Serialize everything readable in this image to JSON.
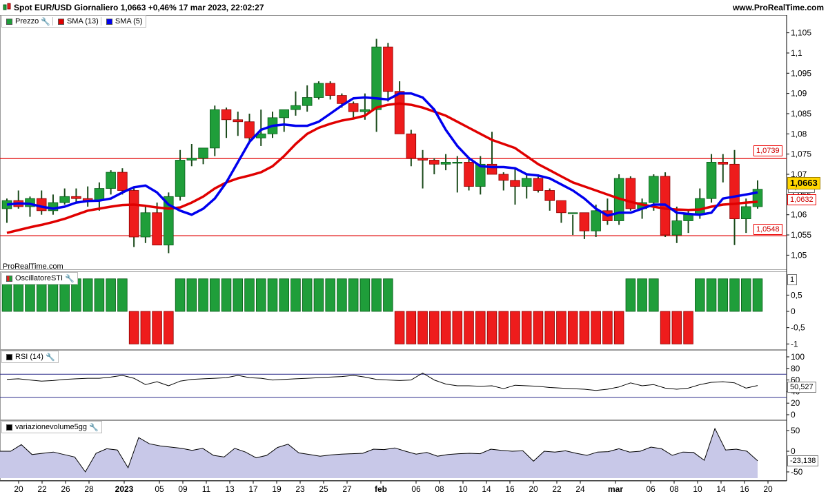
{
  "header": {
    "title": "Spot EUR/USD Giornaliero 1,0663 +0,46% 17 mar 2023, 22:02:27",
    "site": "www.ProRealTime.com"
  },
  "watermark": "ProRealTime.com",
  "legends": {
    "price": {
      "items": [
        {
          "label": "Prezzo",
          "color": "#1f9e3a",
          "icon": "candle-icon"
        },
        {
          "label": "SMA (13)",
          "color": "#e00000"
        },
        {
          "label": "SMA (5)",
          "color": "#0000ee"
        }
      ]
    },
    "sti": {
      "label": "OscillatoreSTI"
    },
    "rsi": {
      "label": "RSI (14)"
    },
    "vol": {
      "label": "variazionevolume5gg"
    }
  },
  "price_axis": {
    "ticks": [
      "1,105",
      "1,1",
      "1,095",
      "1,09",
      "1,085",
      "1,08",
      "1,075",
      "1,07",
      "1,065",
      "1,06",
      "1,055",
      "1,05"
    ],
    "boxes": {
      "current": "1,0663",
      "line_top": "1,0739",
      "line_bottom": "1,0548",
      "sma13": "1,0632",
      "hidden": "1,0662"
    }
  },
  "sti_axis": {
    "ticks": [
      "0,5",
      "0",
      "-0,5",
      "-1"
    ],
    "box": "1"
  },
  "rsi_axis": {
    "ticks": [
      "100",
      "80",
      "60",
      "40",
      "20",
      "0"
    ],
    "box": "50,527"
  },
  "vol_axis": {
    "ticks": [
      "50",
      "0",
      "-50"
    ],
    "box": "-23,138"
  },
  "x_axis": {
    "labels": [
      "20",
      "22",
      "26",
      "28",
      "2023",
      "05",
      "09",
      "11",
      "13",
      "17",
      "19",
      "23",
      "25",
      "27",
      "feb",
      "06",
      "08",
      "10",
      "14",
      "16",
      "20",
      "22",
      "24",
      "mar",
      "06",
      "08",
      "10",
      "14",
      "16",
      "20"
    ]
  },
  "chart_data": [
    {
      "type": "candlestick",
      "title": "Spot EUR/USD Giornaliero",
      "ylim": [
        1.047,
        1.108
      ],
      "hlines": [
        1.0739,
        1.0548
      ],
      "ohlc": [
        [
          1.0615,
          1.064,
          1.058,
          1.0635
        ],
        [
          1.0635,
          1.066,
          1.0615,
          1.062
        ],
        [
          1.062,
          1.0645,
          1.0595,
          1.064
        ],
        [
          1.064,
          1.066,
          1.06,
          1.061
        ],
        [
          1.061,
          1.065,
          1.06,
          1.063
        ],
        [
          1.063,
          1.0665,
          1.0625,
          1.0645
        ],
        [
          1.0645,
          1.0665,
          1.063,
          1.064
        ],
        [
          1.064,
          1.067,
          1.062,
          1.0635
        ],
        [
          1.0635,
          1.068,
          1.061,
          1.0665
        ],
        [
          1.0665,
          1.071,
          1.065,
          1.0705
        ],
        [
          1.0705,
          1.0715,
          1.065,
          1.066
        ],
        [
          1.066,
          1.0665,
          1.052,
          1.0545
        ],
        [
          1.0545,
          1.062,
          1.053,
          1.0605
        ],
        [
          1.0605,
          1.063,
          1.0525,
          1.0525
        ],
        [
          1.0525,
          1.0655,
          1.0505,
          1.0645
        ],
        [
          1.0645,
          1.076,
          1.0635,
          1.0735
        ],
        [
          1.0735,
          1.0775,
          1.072,
          1.074
        ],
        [
          1.074,
          1.0765,
          1.0725,
          1.0765
        ],
        [
          1.0765,
          1.087,
          1.0745,
          1.086
        ],
        [
          1.086,
          1.0865,
          1.079,
          1.0835
        ],
        [
          1.0835,
          1.0855,
          1.0795,
          1.083
        ],
        [
          1.083,
          1.085,
          1.078,
          1.079
        ],
        [
          1.079,
          1.086,
          1.077,
          1.08
        ],
        [
          1.08,
          1.0855,
          1.079,
          1.084
        ],
        [
          1.084,
          1.0855,
          1.0805,
          1.086
        ],
        [
          1.086,
          1.0905,
          1.0845,
          1.087
        ],
        [
          1.087,
          1.092,
          1.0855,
          1.089
        ],
        [
          1.089,
          1.093,
          1.0885,
          1.0925
        ],
        [
          1.0925,
          1.093,
          1.0885,
          1.0895
        ],
        [
          1.0895,
          1.09,
          1.0865,
          1.0875
        ],
        [
          1.0875,
          1.088,
          1.084,
          1.0855
        ],
        [
          1.0855,
          1.09,
          1.0835,
          1.086
        ],
        [
          1.086,
          1.1035,
          1.0805,
          1.1015
        ],
        [
          1.1015,
          1.1025,
          1.088,
          1.0905
        ],
        [
          1.0905,
          1.093,
          1.08,
          1.08
        ],
        [
          1.08,
          1.081,
          1.072,
          1.074
        ],
        [
          1.074,
          1.076,
          1.0665,
          1.0735
        ],
        [
          1.0735,
          1.074,
          1.07,
          1.0725
        ],
        [
          1.0725,
          1.075,
          1.071,
          1.073
        ],
        [
          1.073,
          1.0745,
          1.0655,
          1.073
        ],
        [
          1.073,
          1.074,
          1.066,
          1.067
        ],
        [
          1.067,
          1.0745,
          1.065,
          1.0725
        ],
        [
          1.0725,
          1.0805,
          1.0715,
          1.07
        ],
        [
          1.07,
          1.0705,
          1.066,
          1.0685
        ],
        [
          1.0685,
          1.0715,
          1.0625,
          1.067
        ],
        [
          1.067,
          1.07,
          1.064,
          1.069
        ],
        [
          1.069,
          1.07,
          1.0655,
          1.066
        ],
        [
          1.066,
          1.0665,
          1.061,
          1.0635
        ],
        [
          1.0635,
          1.0635,
          1.058,
          1.0605
        ],
        [
          1.0605,
          1.06,
          1.055,
          1.0605
        ],
        [
          1.0605,
          1.0605,
          1.054,
          1.056
        ],
        [
          1.056,
          1.0625,
          1.0545,
          1.061
        ],
        [
          1.061,
          1.064,
          1.0575,
          1.0585
        ],
        [
          1.0585,
          1.07,
          1.0575,
          1.069
        ],
        [
          1.069,
          1.0695,
          1.061,
          1.0615
        ],
        [
          1.0615,
          1.064,
          1.059,
          1.063
        ],
        [
          1.063,
          1.07,
          1.061,
          1.0695
        ],
        [
          1.0695,
          1.0705,
          1.0545,
          1.055
        ],
        [
          1.055,
          1.062,
          1.053,
          1.0585
        ],
        [
          1.0585,
          1.061,
          1.0555,
          1.06
        ],
        [
          1.06,
          1.0665,
          1.059,
          1.064
        ],
        [
          1.064,
          1.075,
          1.063,
          1.073
        ],
        [
          1.073,
          1.075,
          1.068,
          1.0725
        ],
        [
          1.0725,
          1.076,
          1.0525,
          1.059
        ],
        [
          1.059,
          1.064,
          1.0555,
          1.062
        ],
        [
          1.062,
          1.0685,
          1.0615,
          1.0663
        ]
      ]
    },
    {
      "type": "line",
      "title": "SMA (13)",
      "color": "#e00000",
      "values": [
        1.0555,
        1.0562,
        1.0569,
        1.0575,
        1.0582,
        1.059,
        1.06,
        1.061,
        1.0615,
        1.062,
        1.0624,
        1.0625,
        1.0622,
        1.0618,
        1.0615,
        1.0618,
        1.063,
        1.0645,
        1.0665,
        1.068,
        1.069,
        1.0697,
        1.0705,
        1.072,
        1.0745,
        1.0775,
        1.08,
        1.0815,
        1.0825,
        1.0833,
        1.0838,
        1.0845,
        1.0865,
        1.0872,
        1.0875,
        1.0872,
        1.0865,
        1.0855,
        1.0845,
        1.083,
        1.0815,
        1.08,
        1.0785,
        1.0775,
        1.0765,
        1.0745,
        1.0725,
        1.071,
        1.0695,
        1.068,
        1.067,
        1.066,
        1.065,
        1.064,
        1.0632,
        1.0625,
        1.062,
        1.0615,
        1.0613,
        1.0612,
        1.0613,
        1.062,
        1.0625,
        1.0627,
        1.063,
        1.0632
      ]
    },
    {
      "type": "line",
      "title": "SMA (5)",
      "color": "#0000ee",
      "values": [
        1.0625,
        1.0628,
        1.0627,
        1.062,
        1.0615,
        1.062,
        1.063,
        1.0634,
        1.0635,
        1.064,
        1.0655,
        1.0668,
        1.0672,
        1.0655,
        1.0625,
        1.061,
        1.06,
        1.0615,
        1.064,
        1.068,
        1.073,
        1.078,
        1.081,
        1.082,
        1.0823,
        1.082,
        1.082,
        1.083,
        1.085,
        1.087,
        1.0888,
        1.089,
        1.0888,
        1.0885,
        1.09,
        1.09,
        1.089,
        1.086,
        1.081,
        1.077,
        1.074,
        1.072,
        1.0718,
        1.0718,
        1.0715,
        1.07,
        1.0697,
        1.069,
        1.0675,
        1.066,
        1.064,
        1.0615,
        1.0598,
        1.0605,
        1.0605,
        1.0615,
        1.0625,
        1.0625,
        1.0605,
        1.0602,
        1.06,
        1.0605,
        1.064,
        1.0645,
        1.065,
        1.0655
      ]
    },
    {
      "type": "bar",
      "title": "OscillatoreSTI",
      "ylim": [
        -1.1,
        1.1
      ],
      "values": [
        1,
        1,
        1,
        1,
        1,
        1,
        1,
        1,
        1,
        1,
        1,
        -1,
        -1,
        -1,
        -1,
        1,
        1,
        1,
        1,
        1,
        1,
        1,
        1,
        1,
        1,
        1,
        1,
        1,
        1,
        1,
        1,
        1,
        1,
        1,
        -1,
        -1,
        -1,
        -1,
        -1,
        -1,
        -1,
        -1,
        -1,
        -1,
        -1,
        -1,
        -1,
        -1,
        -1,
        -1,
        -1,
        -1,
        -1,
        -1,
        1,
        1,
        1,
        -1,
        -1,
        -1,
        1,
        1,
        1,
        1,
        1,
        1
      ]
    },
    {
      "type": "line",
      "title": "RSI (14)",
      "ylim": [
        0,
        100
      ],
      "levels": [
        70,
        30
      ],
      "values": [
        61,
        62,
        60,
        58,
        59,
        61,
        62,
        63,
        63,
        65,
        68,
        63,
        52,
        57,
        50,
        58,
        61,
        62,
        63,
        64,
        68,
        64,
        63,
        60,
        61,
        62,
        63,
        64,
        65,
        66,
        68,
        65,
        61,
        60,
        59,
        60,
        72,
        60,
        53,
        50,
        50,
        49,
        50,
        45,
        51,
        50,
        49,
        47,
        46,
        45,
        44,
        42,
        44,
        48,
        55,
        50,
        52,
        46,
        44,
        46,
        52,
        56,
        57,
        55,
        46,
        50.527
      ]
    },
    {
      "type": "area",
      "title": "variazionevolume5gg",
      "ylim": [
        -65,
        65
      ],
      "values": [
        0,
        0,
        16,
        -8,
        -5,
        -2,
        -8,
        -14,
        -50,
        -5,
        6,
        3,
        -40,
        33,
        18,
        13,
        10,
        7,
        2,
        7,
        -10,
        -14,
        7,
        -2,
        -16,
        -10,
        9,
        17,
        -4,
        -8,
        -12,
        -9,
        -7,
        -6,
        -5,
        5,
        4,
        8,
        0,
        -7,
        -3,
        -12,
        -8,
        -6,
        -5,
        -6,
        5,
        2,
        0,
        1,
        -24,
        0,
        -2,
        1,
        -5,
        -10,
        -2,
        -1,
        6,
        -2,
        0,
        10,
        6,
        -10,
        -2,
        -3,
        -22,
        55,
        3,
        5,
        0,
        -23.138
      ]
    }
  ]
}
